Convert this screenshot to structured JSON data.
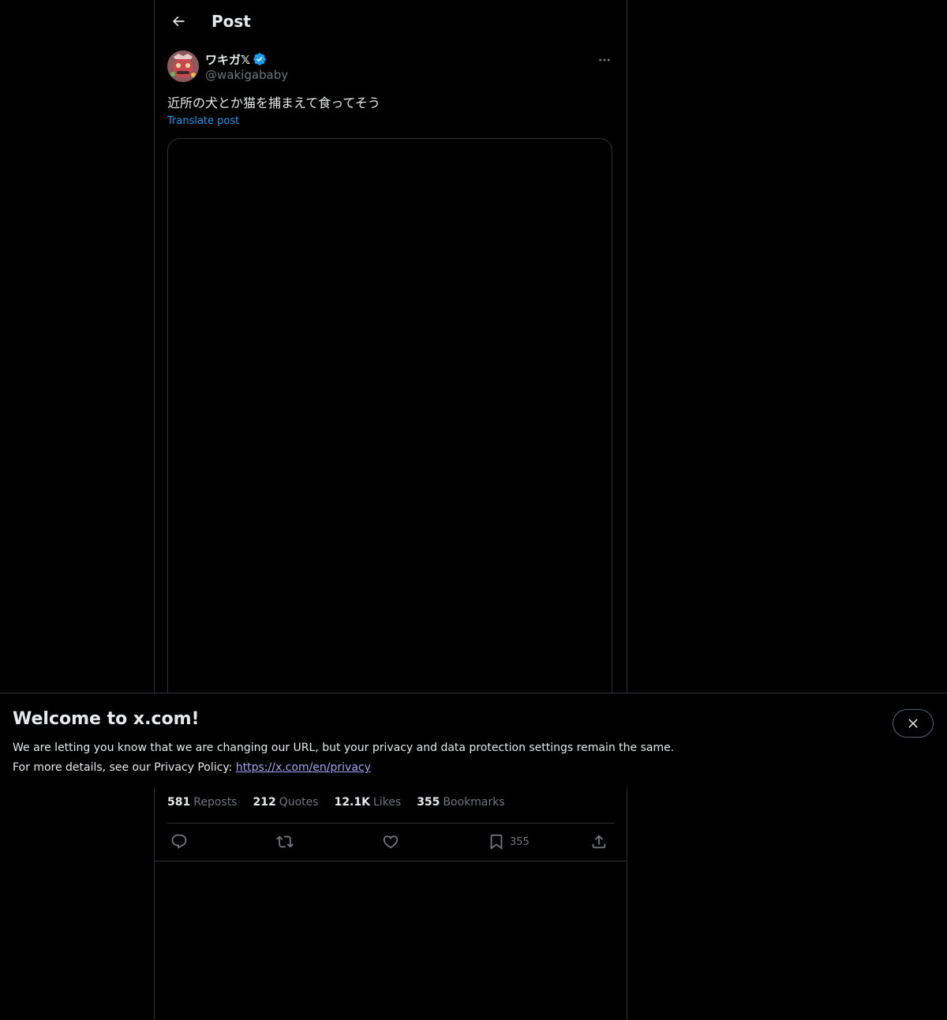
{
  "header": {
    "title": "Post"
  },
  "post": {
    "author": {
      "display_name": "ワキガ𝕏",
      "handle": "@wakigababy",
      "verified": true
    },
    "text": "近所の犬とか猫を捕まえて食ってそう",
    "translate_label": "Translate post",
    "stats": [
      {
        "value": "581",
        "label": "Reposts"
      },
      {
        "value": "212",
        "label": "Quotes"
      },
      {
        "value": "12.1K",
        "label": "Likes"
      },
      {
        "value": "355",
        "label": "Bookmarks"
      }
    ],
    "actions": {
      "bookmark_count": "355"
    }
  },
  "banner": {
    "title": "Welcome to x.com!",
    "line1": "We are letting you know that we are changing our URL, but your privacy and data protection settings remain the same.",
    "line2_prefix": "For more details, see our Privacy Policy: ",
    "link_text": "https://x.com/en/privacy"
  },
  "colors": {
    "accent": "#1d9bf0",
    "border": "#2f3336",
    "muted": "#71767b",
    "link": "#a7a1f3"
  }
}
